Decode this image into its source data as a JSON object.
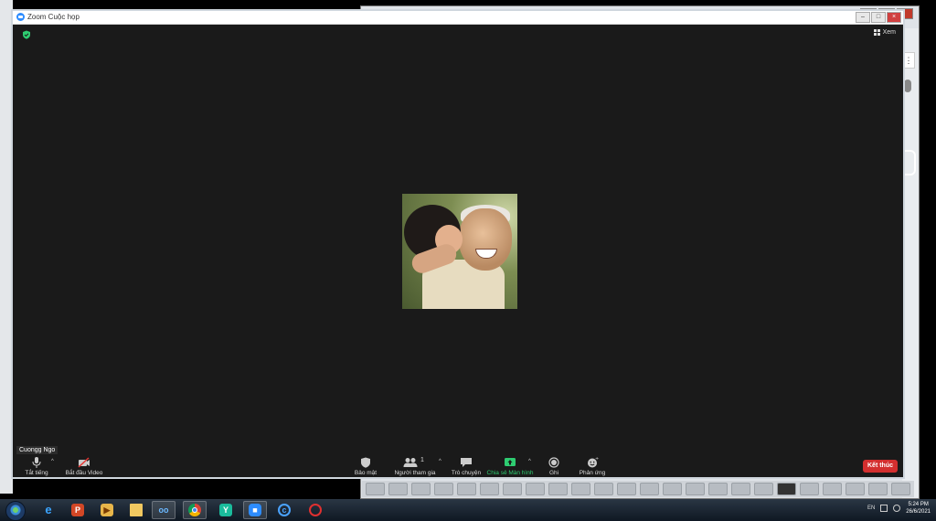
{
  "zoom_window": {
    "title": "Zoom Cuộc họp",
    "view_label": "Xem",
    "participant_name": "Cuongg Ngo"
  },
  "toolbar": {
    "mute_label": "Tắt tiếng",
    "video_label": "Bắt đầu Video",
    "security_label": "Bảo mật",
    "participants_label": "Người tham gia",
    "participants_count": "1",
    "chat_label": "Trò chuyện",
    "share_label": "Chia sẻ Màn hình",
    "record_label": "Ghi",
    "reactions_label": "Phản ứng",
    "end_label": "Kết thúc"
  },
  "taskbar": {
    "language": "EN",
    "time": "5:24 PM",
    "date": "26/6/2021",
    "apps": [
      "internet-explorer",
      "powerpoint",
      "media-player",
      "file-explorer",
      "app-owl",
      "chrome",
      "app-y",
      "zoom",
      "app-c",
      "app-red"
    ]
  },
  "colors": {
    "zoom_bg": "#1a1a1a",
    "end_button": "#d32f2f",
    "share_green": "#2ecc71",
    "zoom_blue": "#2d8cff"
  }
}
